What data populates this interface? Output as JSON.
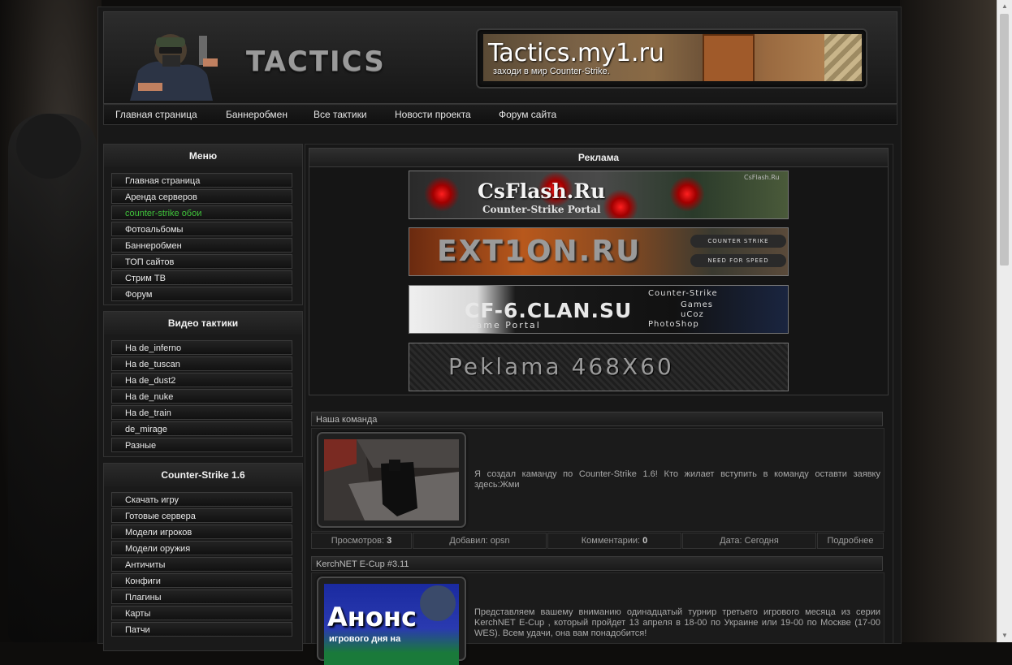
{
  "header": {
    "logo_text": "TACTICS",
    "banner_title": "Tactics.my1.ru",
    "banner_subtitle": "заходи в мир Counter-Strike."
  },
  "nav": [
    "Главная страница",
    "Баннеробмен",
    "Все тактики",
    "Новости проекта",
    "Форум сайта"
  ],
  "sidebar": {
    "menu": {
      "title": "Меню",
      "items": [
        "Главная страница",
        "Аренда серверов",
        "counter-strike обои",
        "Фотоальбомы",
        "Баннеробмен",
        "ТОП сайтов",
        "Стрим ТВ",
        "Форум"
      ]
    },
    "video": {
      "title": "Видео тактики",
      "items": [
        "На de_inferno",
        "На de_tuscan",
        "На de_dust2",
        "На de_nuke",
        "На de_train",
        "de_mirage",
        "Разные"
      ]
    },
    "cs16": {
      "title": "Counter-Strike 1.6",
      "items": [
        "Скачать игру",
        "Готовые сервера",
        "Модели игроков",
        "Модели оружия",
        "Античиты",
        "Конфиги",
        "Плагины",
        "Карты",
        "Патчи"
      ]
    }
  },
  "ads": {
    "title": "Реклама",
    "banners": [
      {
        "main": "CsFlash.Ru",
        "sub": "Counter-Strike Portal",
        "tag": "CsFlash.Ru"
      },
      {
        "main": "EXT1ON.RU",
        "btn1": "COUNTER STRIKE",
        "btn2": "NEED FOR SPEED"
      },
      {
        "main": "CF-6.CLAN.SU",
        "sub": "Game Portal",
        "l1": "Counter-Strike",
        "l2": "Games",
        "l3": "uCoz",
        "l4": "PhotoShop"
      },
      {
        "main": "Peklama  468X60"
      }
    ]
  },
  "news": [
    {
      "title": "Наша команда",
      "text": "Я создал каманду по Counter-Strike 1.6! Кто жилает вступить в команду оставти заявку здесь:Жми",
      "views_label": "Просмотров:",
      "views": "3",
      "added_label": "Добавил:",
      "author": "opsn",
      "comments_label": "Комментарии:",
      "comments": "0",
      "date_label": "Дата:",
      "date": "Сегодня",
      "more": "Подробнее"
    },
    {
      "title": "KerchNET E-Cup #3.11",
      "thumb_big": "Анонс",
      "thumb_small": "игрового дня на",
      "text": "Представляем вашему вниманию одинадцатый турнир третьего игрового месяца из серии KerchNET E-Cup , который пройдет 13 апреля в 18-00 по Украине или 19-00 по Москве (17-00 WES). Всем удачи, она вам понадобится!"
    }
  ],
  "colors": {
    "active_menu": "#3fc23a",
    "background": "#0e0d0c"
  }
}
